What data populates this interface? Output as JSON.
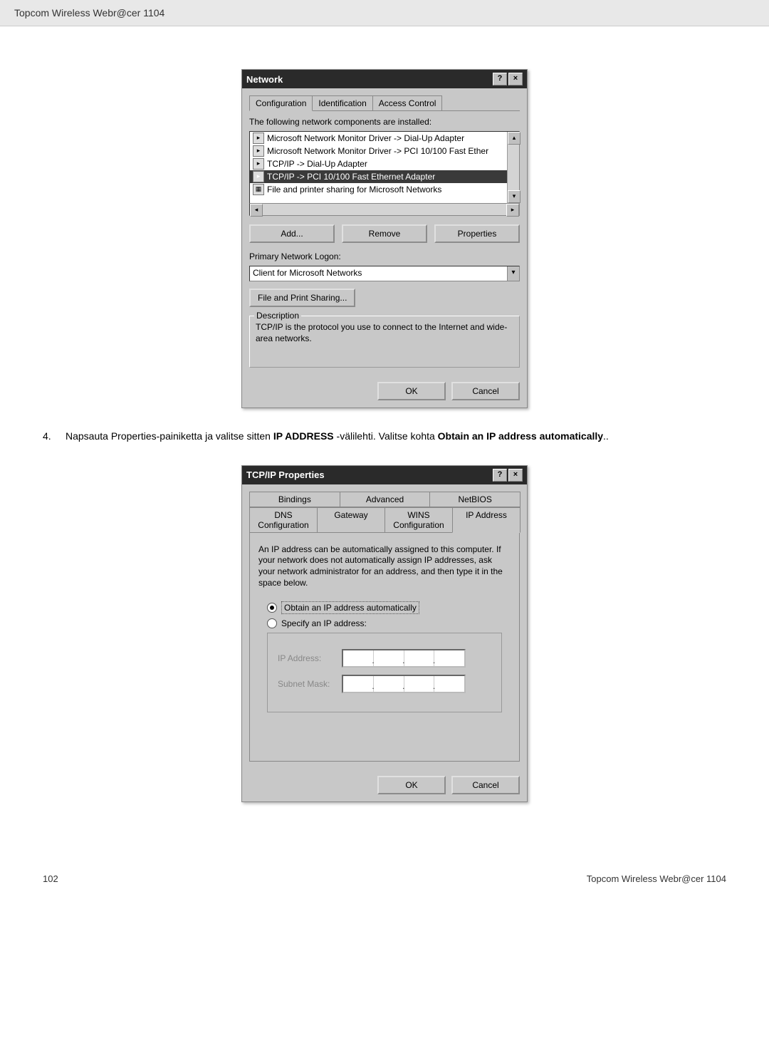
{
  "header": {
    "title": "Topcom Wireless Webr@cer 1104"
  },
  "network_dialog": {
    "title": "Network",
    "tabs": [
      "Configuration",
      "Identification",
      "Access Control"
    ],
    "components_label": "The following network components are installed:",
    "items": [
      "Microsoft Network Monitor Driver -> Dial-Up Adapter",
      "Microsoft Network Monitor Driver -> PCI 10/100 Fast Ether",
      "TCP/IP -> Dial-Up Adapter",
      "TCP/IP -> PCI 10/100 Fast Ethernet Adapter",
      "File and printer sharing for Microsoft Networks"
    ],
    "selected_index": 3,
    "buttons": {
      "add": "Add...",
      "remove": "Remove",
      "properties": "Properties"
    },
    "primary_logon_label": "Primary Network Logon:",
    "primary_logon_value": "Client for Microsoft Networks",
    "file_print_btn": "File and Print Sharing...",
    "description_label": "Description",
    "description_text": "TCP/IP is the protocol you use to connect to the Internet and wide-area networks.",
    "ok": "OK",
    "cancel": "Cancel"
  },
  "instruction": {
    "number": "4.",
    "text_parts": [
      "Napsauta Properties-painiketta ja valitse sitten ",
      "IP ADDRESS",
      " -välilehti. Valitse kohta ",
      "Obtain an IP address automatically",
      ".."
    ]
  },
  "tcpip_dialog": {
    "title": "TCP/IP Properties",
    "tabs_row1": [
      "Bindings",
      "Advanced",
      "NetBIOS"
    ],
    "tabs_row2": [
      "DNS Configuration",
      "Gateway",
      "WINS Configuration",
      "IP Address"
    ],
    "info": "An IP address can be automatically assigned to this computer. If your network does not automatically assign IP addresses, ask your network administrator for an address, and then type it in the space below.",
    "radio_obtain": "Obtain an IP address automatically",
    "radio_specify": "Specify an IP address:",
    "ip_label": "IP Address:",
    "subnet_label": "Subnet Mask:",
    "ok": "OK",
    "cancel": "Cancel"
  },
  "footer": {
    "page": "102",
    "product": "Topcom Wireless Webr@cer 1104"
  }
}
